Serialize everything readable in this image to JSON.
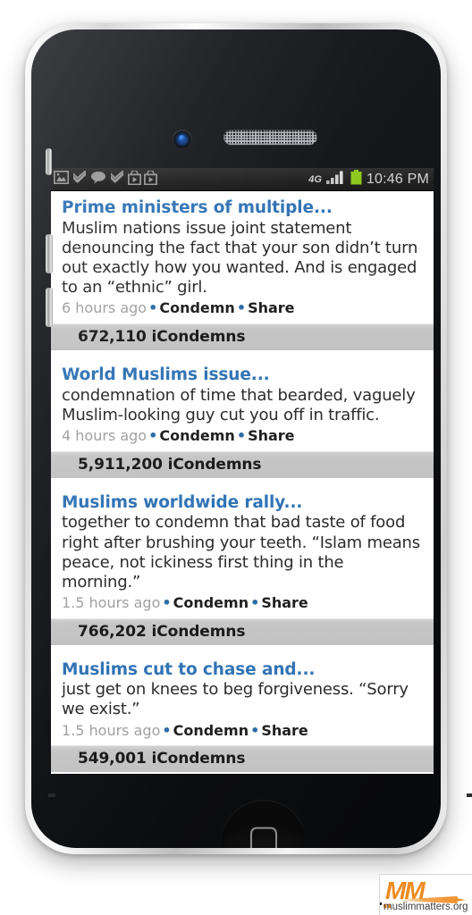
{
  "status_bar": {
    "time": "10:46 PM",
    "network_type": "4G",
    "signal_bars": 4,
    "battery_color": "#8ec81e",
    "notification_icons": [
      "photo-icon",
      "double-check-icon",
      "speech-bubble-icon",
      "double-check-icon",
      "play-store-bag-icon",
      "play-store-bag-icon"
    ]
  },
  "theme": {
    "title_blue": "#3274b5",
    "bullet_blue": "#2e6da4",
    "condemn_bar_gray": "#c6c6c6",
    "body_text": "#2b2b2b",
    "timestamp_gray": "#a0a0a0"
  },
  "feed": {
    "articles": [
      {
        "title": "Prime ministers of multiple...",
        "summary": "Muslim nations issue joint statement denouncing the fact that your son didn’t turn out exactly how you wanted. And is engaged to an “ethnic” girl.",
        "timestamp": "6 hours ago",
        "action_condemn": "Condemn",
        "action_share": "Share",
        "separator": "•",
        "condemn_count": "672,110 iCondemns"
      },
      {
        "title": "World Muslims issue...",
        "summary": "condemnation of time that bearded, vaguely Muslim-looking guy cut you off in traffic.",
        "timestamp": "4 hours ago",
        "action_condemn": "Condemn",
        "action_share": "Share",
        "separator": "•",
        "condemn_count": "5,911,200 iCondemns"
      },
      {
        "title": "Muslims worldwide rally...",
        "summary": "together to condemn that bad taste of food right after brushing your teeth. “Islam means peace, not ickiness first thing in the morning.”",
        "timestamp": "1.5 hours ago",
        "action_condemn": "Condemn",
        "action_share": "Share",
        "separator": "•",
        "condemn_count": "766,202 iCondemns"
      },
      {
        "title": "Muslims cut to chase and...",
        "summary": "just get on knees to beg forgiveness. “Sorry we exist.”",
        "timestamp": "1.5 hours ago",
        "action_condemn": "Condemn",
        "action_share": "Share",
        "separator": "•",
        "condemn_count": "549,001 iCondemns"
      }
    ]
  },
  "watermark": {
    "mark": "MM",
    "dots": "..",
    "url": "muslimmatters.org"
  }
}
